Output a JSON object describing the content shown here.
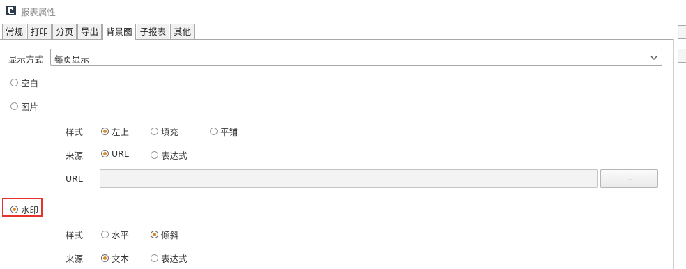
{
  "window": {
    "title": "报表属性"
  },
  "tabs": [
    {
      "label": "常规",
      "active": false
    },
    {
      "label": "打印",
      "active": false
    },
    {
      "label": "分页",
      "active": false
    },
    {
      "label": "导出",
      "active": false
    },
    {
      "label": "背景图",
      "active": true
    },
    {
      "label": "子报表",
      "active": false
    },
    {
      "label": "其他",
      "active": false
    }
  ],
  "display_mode": {
    "label": "显示方式",
    "value": "每页显示"
  },
  "background_type": {
    "blank": {
      "label": "空白",
      "checked": false
    },
    "image": {
      "label": "图片",
      "checked": false
    },
    "watermark": {
      "label": "水印",
      "checked": true
    }
  },
  "image_options": {
    "style_label": "样式",
    "style_options": [
      {
        "label": "左上",
        "checked": true
      },
      {
        "label": "填充",
        "checked": false
      },
      {
        "label": "平铺",
        "checked": false
      }
    ],
    "source_label": "来源",
    "source_options": [
      {
        "label": "URL",
        "checked": true
      },
      {
        "label": "表达式",
        "checked": false
      }
    ],
    "url_label": "URL",
    "url_value": "",
    "browse_button": "..."
  },
  "watermark_options": {
    "style_label": "样式",
    "style_options": [
      {
        "label": "水平",
        "checked": false
      },
      {
        "label": "倾斜",
        "checked": true
      }
    ],
    "source_label": "来源",
    "source_options": [
      {
        "label": "文本",
        "checked": true
      },
      {
        "label": "表达式",
        "checked": false
      }
    ]
  },
  "colors": {
    "radio_selected": "#d98a2b",
    "highlight": "#e8322e"
  }
}
